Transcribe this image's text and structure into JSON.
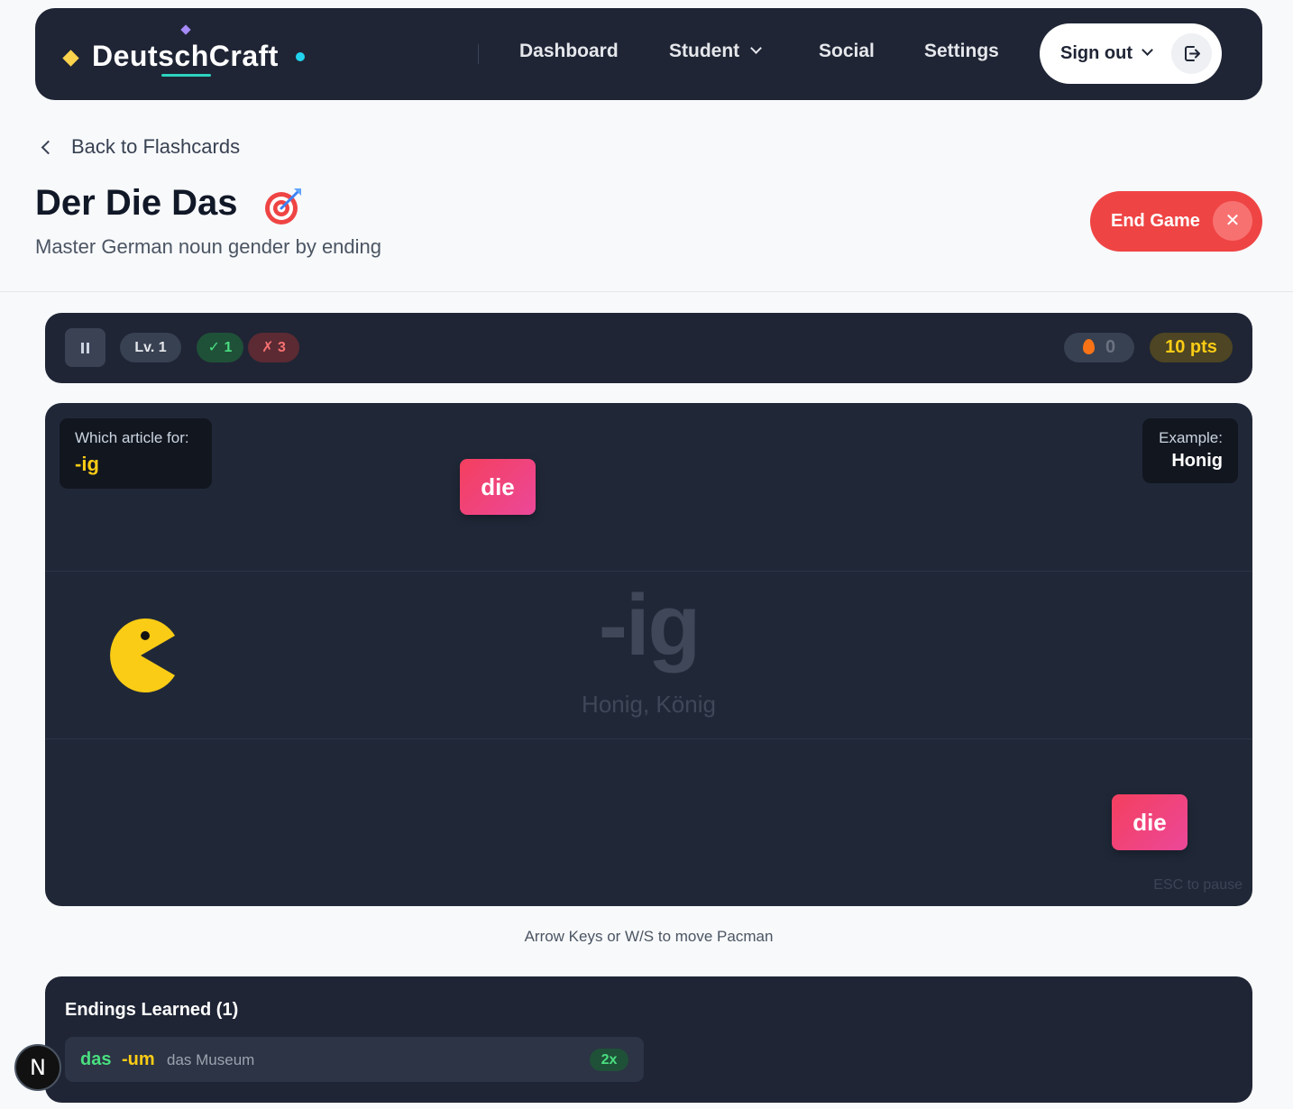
{
  "nav": {
    "brand": "DeutschCraft",
    "links": [
      "Dashboard",
      "Student",
      "Social",
      "Settings"
    ],
    "sign_out": "Sign out"
  },
  "header": {
    "back_label": "Back to Flashcards",
    "title": "Der Die Das",
    "subtitle": "Master German noun gender by ending",
    "end_game": "End Game"
  },
  "stats": {
    "level": "Lv. 1",
    "correct": "✓ 1",
    "wrong": "✗ 3",
    "streak": "0",
    "points": "10 pts"
  },
  "game": {
    "question_label": "Which article for:",
    "question_value": "-ig",
    "example_label": "Example:",
    "example_value": "Honig",
    "cards": [
      "die",
      "die"
    ],
    "center_ending": "-ig",
    "center_examples": "Honig, König",
    "esc_hint": "ESC to pause"
  },
  "hint": "Arrow Keys or W/S to move Pacman",
  "endings": {
    "title": "Endings Learned (1)",
    "items": [
      {
        "article": "das",
        "ending": "-um",
        "example": "das Museum",
        "count": "2x"
      }
    ]
  },
  "dev_badge": "N",
  "colors": {
    "navy": "#1f2535",
    "accent_red": "#ef4444",
    "card_pink": "#ec4899",
    "correct_green": "#4ade80",
    "points_yellow": "#facc15"
  },
  "icons": [
    "diamond-icon",
    "chevron-down-icon",
    "logout-icon",
    "chevron-left-icon",
    "target-icon",
    "close-icon",
    "pause-icon",
    "fire-icon",
    "pacman-icon"
  ]
}
